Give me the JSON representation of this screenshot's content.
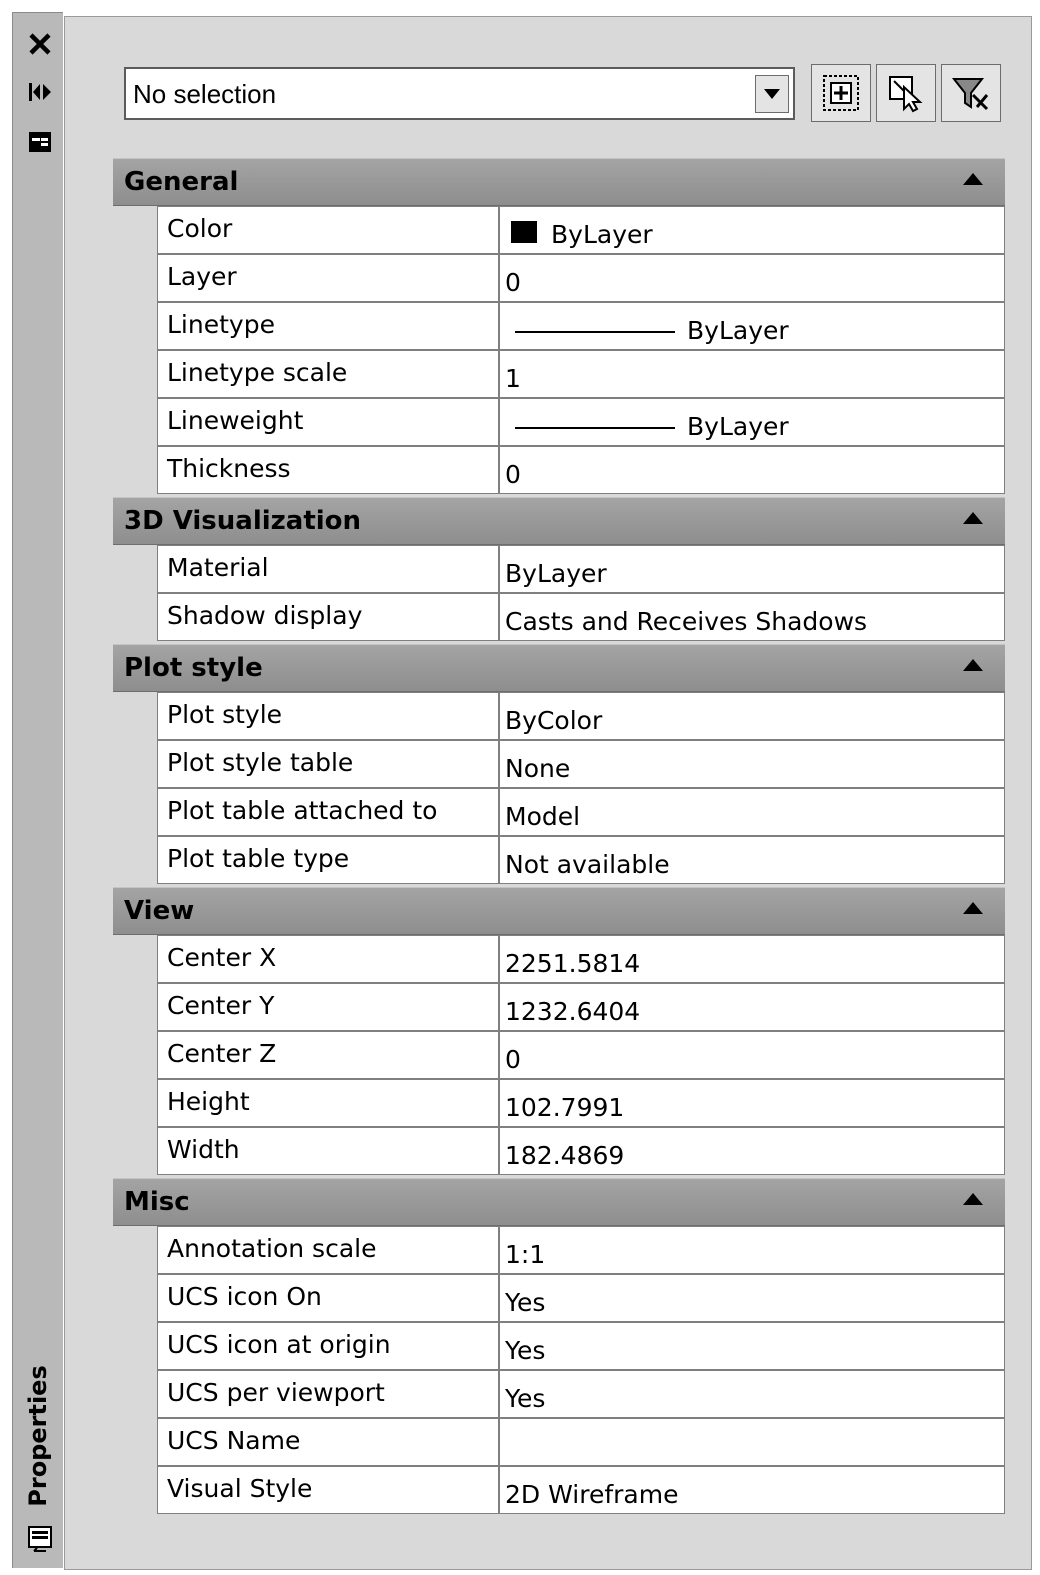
{
  "palette": {
    "strip_bg": "#b9b9b9",
    "panel_bg": "#d9d9d9",
    "header_bg": "#9a9a9a",
    "value_bg": "#ffffff"
  },
  "side_strip": {
    "icons": [
      "close-icon",
      "auto-hide-icon",
      "properties-menu-icon",
      "properties-panel-icon"
    ],
    "title": "Properties"
  },
  "toolbar": {
    "selection": "No selection",
    "buttons": [
      "toggle-pickadd-icon",
      "select-objects-icon",
      "quick-select-icon"
    ]
  },
  "sections": [
    {
      "title": "General",
      "rows": [
        {
          "name": "Color",
          "value": "ByLayer",
          "swatch": "#000000"
        },
        {
          "name": "Layer",
          "value": "0"
        },
        {
          "name": "Linetype",
          "value": "ByLayer",
          "line": true
        },
        {
          "name": "Linetype scale",
          "value": "1"
        },
        {
          "name": "Lineweight",
          "value": "ByLayer",
          "line": true
        },
        {
          "name": "Thickness",
          "value": "0"
        }
      ]
    },
    {
      "title": "3D Visualization",
      "rows": [
        {
          "name": "Material",
          "value": "ByLayer"
        },
        {
          "name": "Shadow display",
          "value": "Casts and Receives Shadows"
        }
      ]
    },
    {
      "title": "Plot style",
      "rows": [
        {
          "name": "Plot style",
          "value": "ByColor",
          "readonly": true
        },
        {
          "name": "Plot style table",
          "value": "None"
        },
        {
          "name": "Plot table attached to",
          "value": "Model"
        },
        {
          "name": "Plot table type",
          "value": "Not available",
          "readonly": true
        }
      ]
    },
    {
      "title": "View",
      "rows": [
        {
          "name": "Center X",
          "value": "2251.5814"
        },
        {
          "name": "Center Y",
          "value": "1232.6404"
        },
        {
          "name": "Center Z",
          "value": "0"
        },
        {
          "name": "Height",
          "value": "102.7991"
        },
        {
          "name": "Width",
          "value": "182.4869"
        }
      ]
    },
    {
      "title": "Misc",
      "rows": [
        {
          "name": "Annotation scale",
          "value": "1:1"
        },
        {
          "name": "UCS icon On",
          "value": "Yes"
        },
        {
          "name": "UCS icon at origin",
          "value": "Yes"
        },
        {
          "name": "UCS per viewport",
          "value": "Yes"
        },
        {
          "name": "UCS Name",
          "value": ""
        },
        {
          "name": "Visual Style",
          "value": "2D Wireframe"
        }
      ]
    }
  ]
}
